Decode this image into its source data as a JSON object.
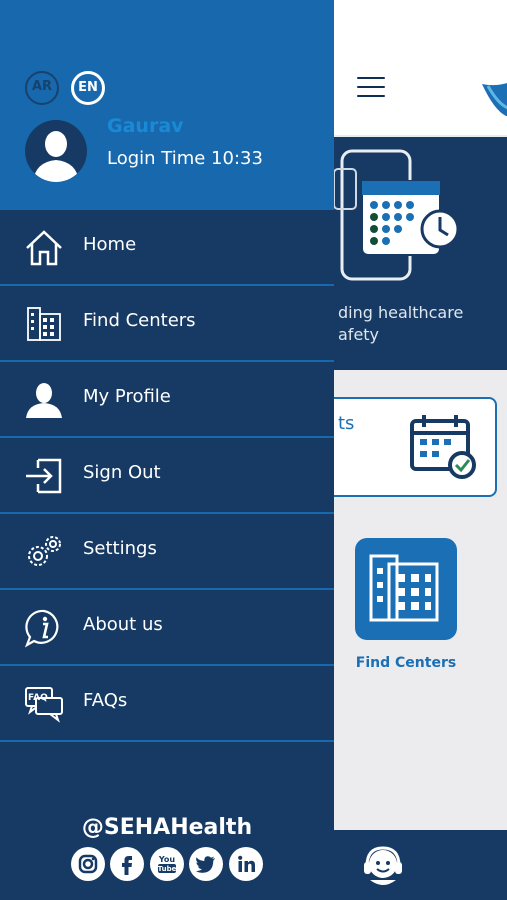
{
  "drawer": {
    "languages": {
      "ar": "AR",
      "en": "EN"
    },
    "user": {
      "name": "Gaurav",
      "login_time": "Login Time 10:33"
    },
    "menu": [
      {
        "label": "Home",
        "icon": "home-icon"
      },
      {
        "label": "Find Centers",
        "icon": "building-icon"
      },
      {
        "label": "My Profile",
        "icon": "user-icon"
      },
      {
        "label": "Sign Out",
        "icon": "sign-out-icon"
      },
      {
        "label": "Settings",
        "icon": "gears-icon"
      },
      {
        "label": "About us",
        "icon": "info-bubble-icon"
      },
      {
        "label": "FAQs",
        "icon": "faq-icon"
      }
    ],
    "social_handle": "@SEHAHealth",
    "social": [
      "instagram-icon",
      "facebook-icon",
      "youtube-icon",
      "twitter-icon",
      "linkedin-icon"
    ]
  },
  "background": {
    "hero_text": "ding healthcare afety",
    "appointments_label": "ts",
    "find_centers_label": "Find Centers"
  },
  "colors": {
    "drawer_bg": "#163a63",
    "header_bg": "#1768ac",
    "accent": "#1b6fb5",
    "user_name": "#1b8ad6"
  }
}
